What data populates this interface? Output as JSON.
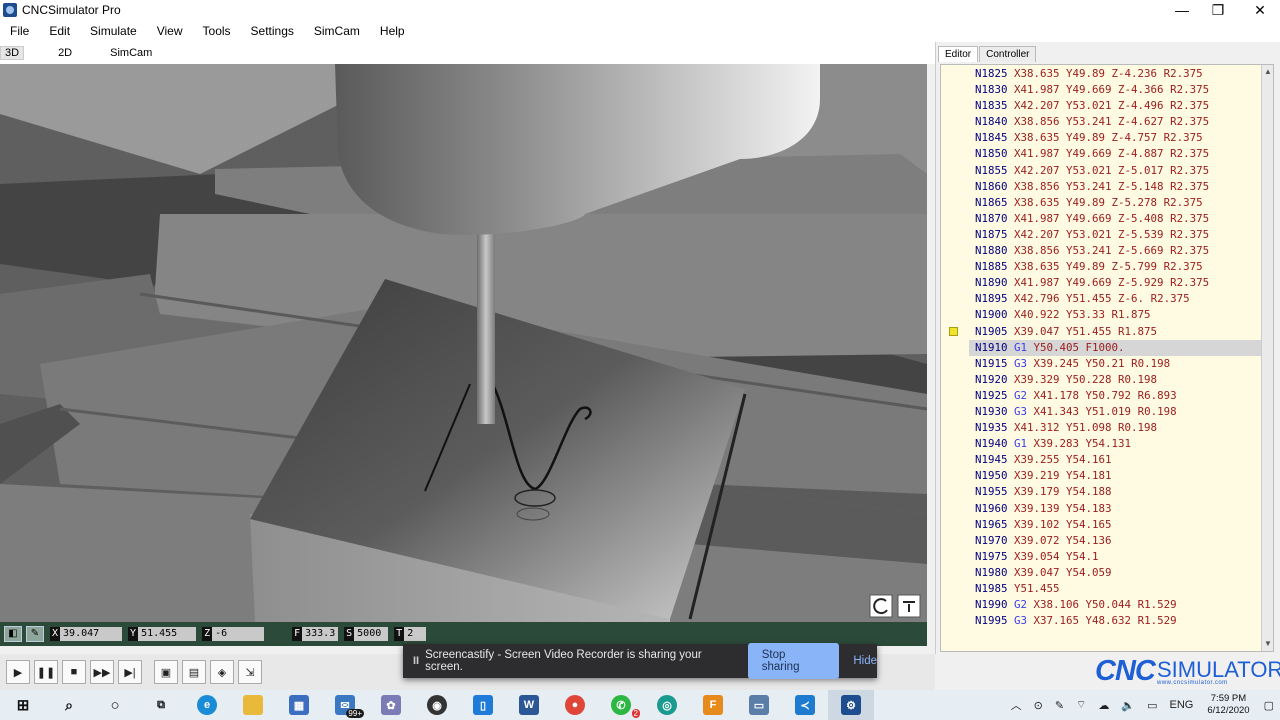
{
  "window": {
    "title": "CNCSimulator Pro",
    "minimize": "—",
    "maximize": "❐",
    "close": "✕"
  },
  "menu": [
    "File",
    "Edit",
    "Simulate",
    "View",
    "Tools",
    "Settings",
    "SimCam",
    "Help"
  ],
  "view_tabs": [
    "3D",
    "2D",
    "SimCam"
  ],
  "panel_tabs": [
    "Editor",
    "Controller"
  ],
  "editor": {
    "current_line_index": 17,
    "marker_line_index": 16,
    "lines": [
      "N1825 X38.635 Y49.89 Z-4.236 R2.375",
      "N1830 X41.987 Y49.669 Z-4.366 R2.375",
      "N1835 X42.207 Y53.021 Z-4.496 R2.375",
      "N1840 X38.856 Y53.241 Z-4.627 R2.375",
      "N1845 X38.635 Y49.89 Z-4.757 R2.375",
      "N1850 X41.987 Y49.669 Z-4.887 R2.375",
      "N1855 X42.207 Y53.021 Z-5.017 R2.375",
      "N1860 X38.856 Y53.241 Z-5.148 R2.375",
      "N1865 X38.635 Y49.89 Z-5.278 R2.375",
      "N1870 X41.987 Y49.669 Z-5.408 R2.375",
      "N1875 X42.207 Y53.021 Z-5.539 R2.375",
      "N1880 X38.856 Y53.241 Z-5.669 R2.375",
      "N1885 X38.635 Y49.89 Z-5.799 R2.375",
      "N1890 X41.987 Y49.669 Z-5.929 R2.375",
      "N1895 X42.796 Y51.455 Z-6. R2.375",
      "N1900 X40.922 Y53.33 R1.875",
      "N1905 X39.047 Y51.455 R1.875",
      "N1910 G1 Y50.405 F1000.",
      "N1915 G3 X39.245 Y50.21 R0.198",
      "N1920 X39.329 Y50.228 R0.198",
      "N1925 G2 X41.178 Y50.792 R6.893",
      "N1930 G3 X41.343 Y51.019 R0.198",
      "N1935 X41.312 Y51.098 R0.198",
      "N1940 G1 X39.283 Y54.131",
      "N1945 X39.255 Y54.161",
      "N1950 X39.219 Y54.181",
      "N1955 X39.179 Y54.188",
      "N1960 X39.139 Y54.183",
      "N1965 X39.102 Y54.165",
      "N1970 X39.072 Y54.136",
      "N1975 X39.054 Y54.1",
      "N1980 X39.047 Y54.059",
      "N1985 Y51.455",
      "N1990 G2 X38.106 Y50.044 R1.529",
      "N1995 G3 X37.165 Y48.632 R1.529"
    ]
  },
  "status": {
    "x_label": "X",
    "x_value": "39.047",
    "y_label": "Y",
    "y_value": "51.455",
    "z_label": "Z",
    "z_value": "-6",
    "f_label": "F",
    "f_value": "333.3",
    "s_label": "S",
    "s_value": "5000",
    "t_label": "T",
    "t_value": "2"
  },
  "sharing_toast": {
    "pause_glyph": "II",
    "message": "Screencastify - Screen Video Recorder is sharing your screen.",
    "stop_label": "Stop sharing",
    "hide_label": "Hide"
  },
  "logo": {
    "cnc": "CNC",
    "simulator": "SIMULATOR",
    "sub": "www.cncsimulator.com"
  },
  "taskbar": {
    "mail_badge": "99+",
    "whatsapp_badge": "2",
    "tray_lang": "ENG",
    "clock_time": "7:59 PM",
    "clock_date": "6/12/2020"
  },
  "colors": {
    "accent": "#1f5fd6",
    "status_bar": "#2c4a3a",
    "editor_bg": "#fffbe3"
  }
}
